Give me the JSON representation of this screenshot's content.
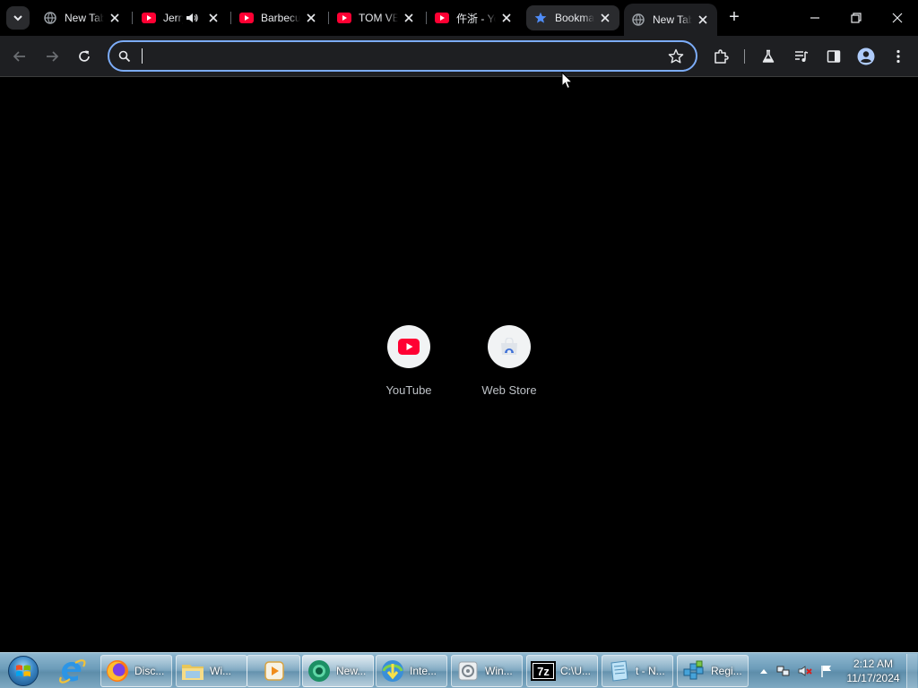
{
  "browser": {
    "tabs": [
      {
        "title": "New Tab",
        "favicon": "globe-icon",
        "state": "normal"
      },
      {
        "title": "Jerry",
        "favicon": "youtube-icon",
        "state": "audio"
      },
      {
        "title": "Barbecue",
        "favicon": "youtube-icon",
        "state": "normal"
      },
      {
        "title": "TOM VE",
        "favicon": "youtube-icon",
        "state": "normal"
      },
      {
        "title": "仵浙 - YouTube",
        "favicon": "youtube-icon",
        "state": "normal"
      },
      {
        "title": "Bookmarks",
        "favicon": "star-icon",
        "state": "highlighted"
      },
      {
        "title": "New Tab",
        "favicon": "globe-icon",
        "state": "active"
      }
    ],
    "new_tab_symbol": "+",
    "omnibox": {
      "value": "",
      "placeholder": ""
    },
    "accent": "#7cacf8"
  },
  "shortcuts": [
    {
      "label": "YouTube",
      "icon": "youtube-icon"
    },
    {
      "label": "Web Store",
      "icon": "web-store-icon"
    }
  ],
  "taskbar": {
    "tasks": [
      {
        "label": "Disc...",
        "icon": "firefox-icon"
      },
      {
        "label": "Wi...",
        "icon": "folder-icon"
      },
      {
        "label": "",
        "icon": "media-player-icon"
      },
      {
        "label": "New...",
        "icon": "chrome-like-icon"
      },
      {
        "label": "Inte...",
        "icon": "download-manager-icon"
      },
      {
        "label": "Win...",
        "icon": "disc-app-icon"
      },
      {
        "label": "C:\\U...",
        "icon": "7zip-icon"
      },
      {
        "label": "t - N...",
        "icon": "notepad-icon"
      },
      {
        "label": "Regi...",
        "icon": "registry-icon"
      }
    ],
    "clock": {
      "time": "2:12 AM",
      "date": "11/17/2024"
    }
  }
}
